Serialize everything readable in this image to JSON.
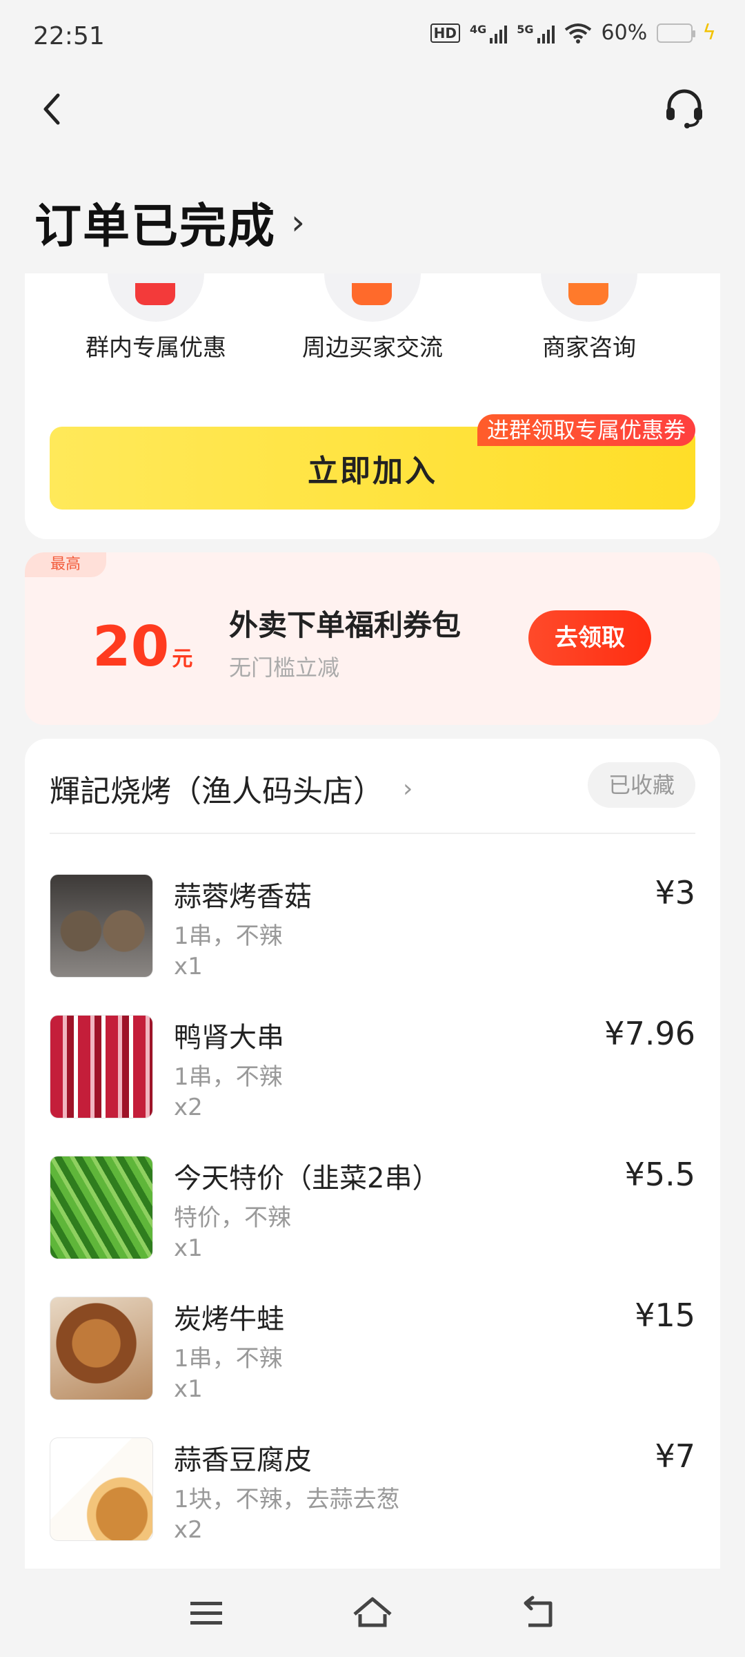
{
  "status_bar": {
    "time": "22:51",
    "hd": "HD",
    "net1": "4G",
    "net2": "5G",
    "battery": "60%"
  },
  "header": {
    "title": "订单已完成"
  },
  "group": {
    "items": [
      {
        "label": "群内专属优惠",
        "icon": "coupon-icon"
      },
      {
        "label": "周边买家交流",
        "icon": "chat-icon"
      },
      {
        "label": "商家咨询",
        "icon": "message-icon"
      }
    ],
    "join_label": "立即加入",
    "join_tag": "进群领取专属优惠券"
  },
  "coupon": {
    "max_tag": "最高",
    "amount": "20",
    "unit": "元",
    "title": "外卖下单福利券包",
    "subtitle": "无门槛立减",
    "button": "去领取"
  },
  "store": {
    "name": "輝記烧烤（渔人码头店）",
    "favorite": "已收藏",
    "items": [
      {
        "name": "蒜蓉烤香菇",
        "spec": "1串，不辣",
        "qty": "x1",
        "price": "¥3"
      },
      {
        "name": "鸭肾大串",
        "spec": "1串，不辣",
        "qty": "x2",
        "price": "¥7.96"
      },
      {
        "name": "今天特价（韭菜2串）",
        "spec": "特价，不辣",
        "qty": "x1",
        "price": "¥5.5"
      },
      {
        "name": "炭烤牛蛙",
        "spec": "1串，不辣",
        "qty": "x1",
        "price": "¥15"
      },
      {
        "name": "蒜香豆腐皮",
        "spec": "1块，不辣，去蒜去葱",
        "qty": "x2",
        "price": "¥7"
      }
    ]
  },
  "colors": {
    "accent_yellow": "#ffde28",
    "accent_red": "#ff3b1f",
    "battery_green": "#3ddc4b"
  }
}
